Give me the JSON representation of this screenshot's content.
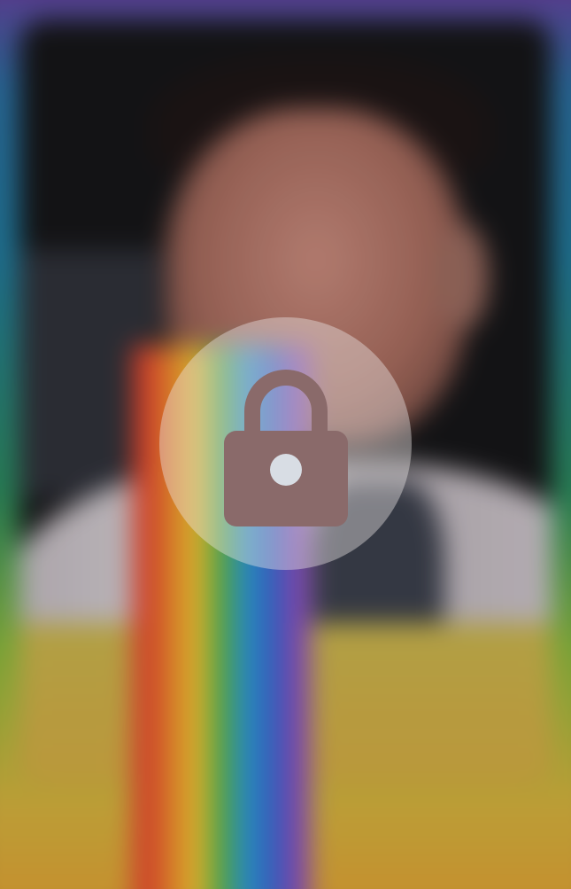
{
  "overlay": {
    "icon": "lock-icon",
    "state": "locked",
    "colors": {
      "circle": "#ebe6e8",
      "lock_body": "#8a6a6a",
      "keyhole": "#d8dde4"
    }
  },
  "rainbow_colors": [
    "#e8452c",
    "#f08a2a",
    "#f2c42e",
    "#5ab84a",
    "#2a9ad6",
    "#3a6ad0",
    "#8a4ac0"
  ]
}
